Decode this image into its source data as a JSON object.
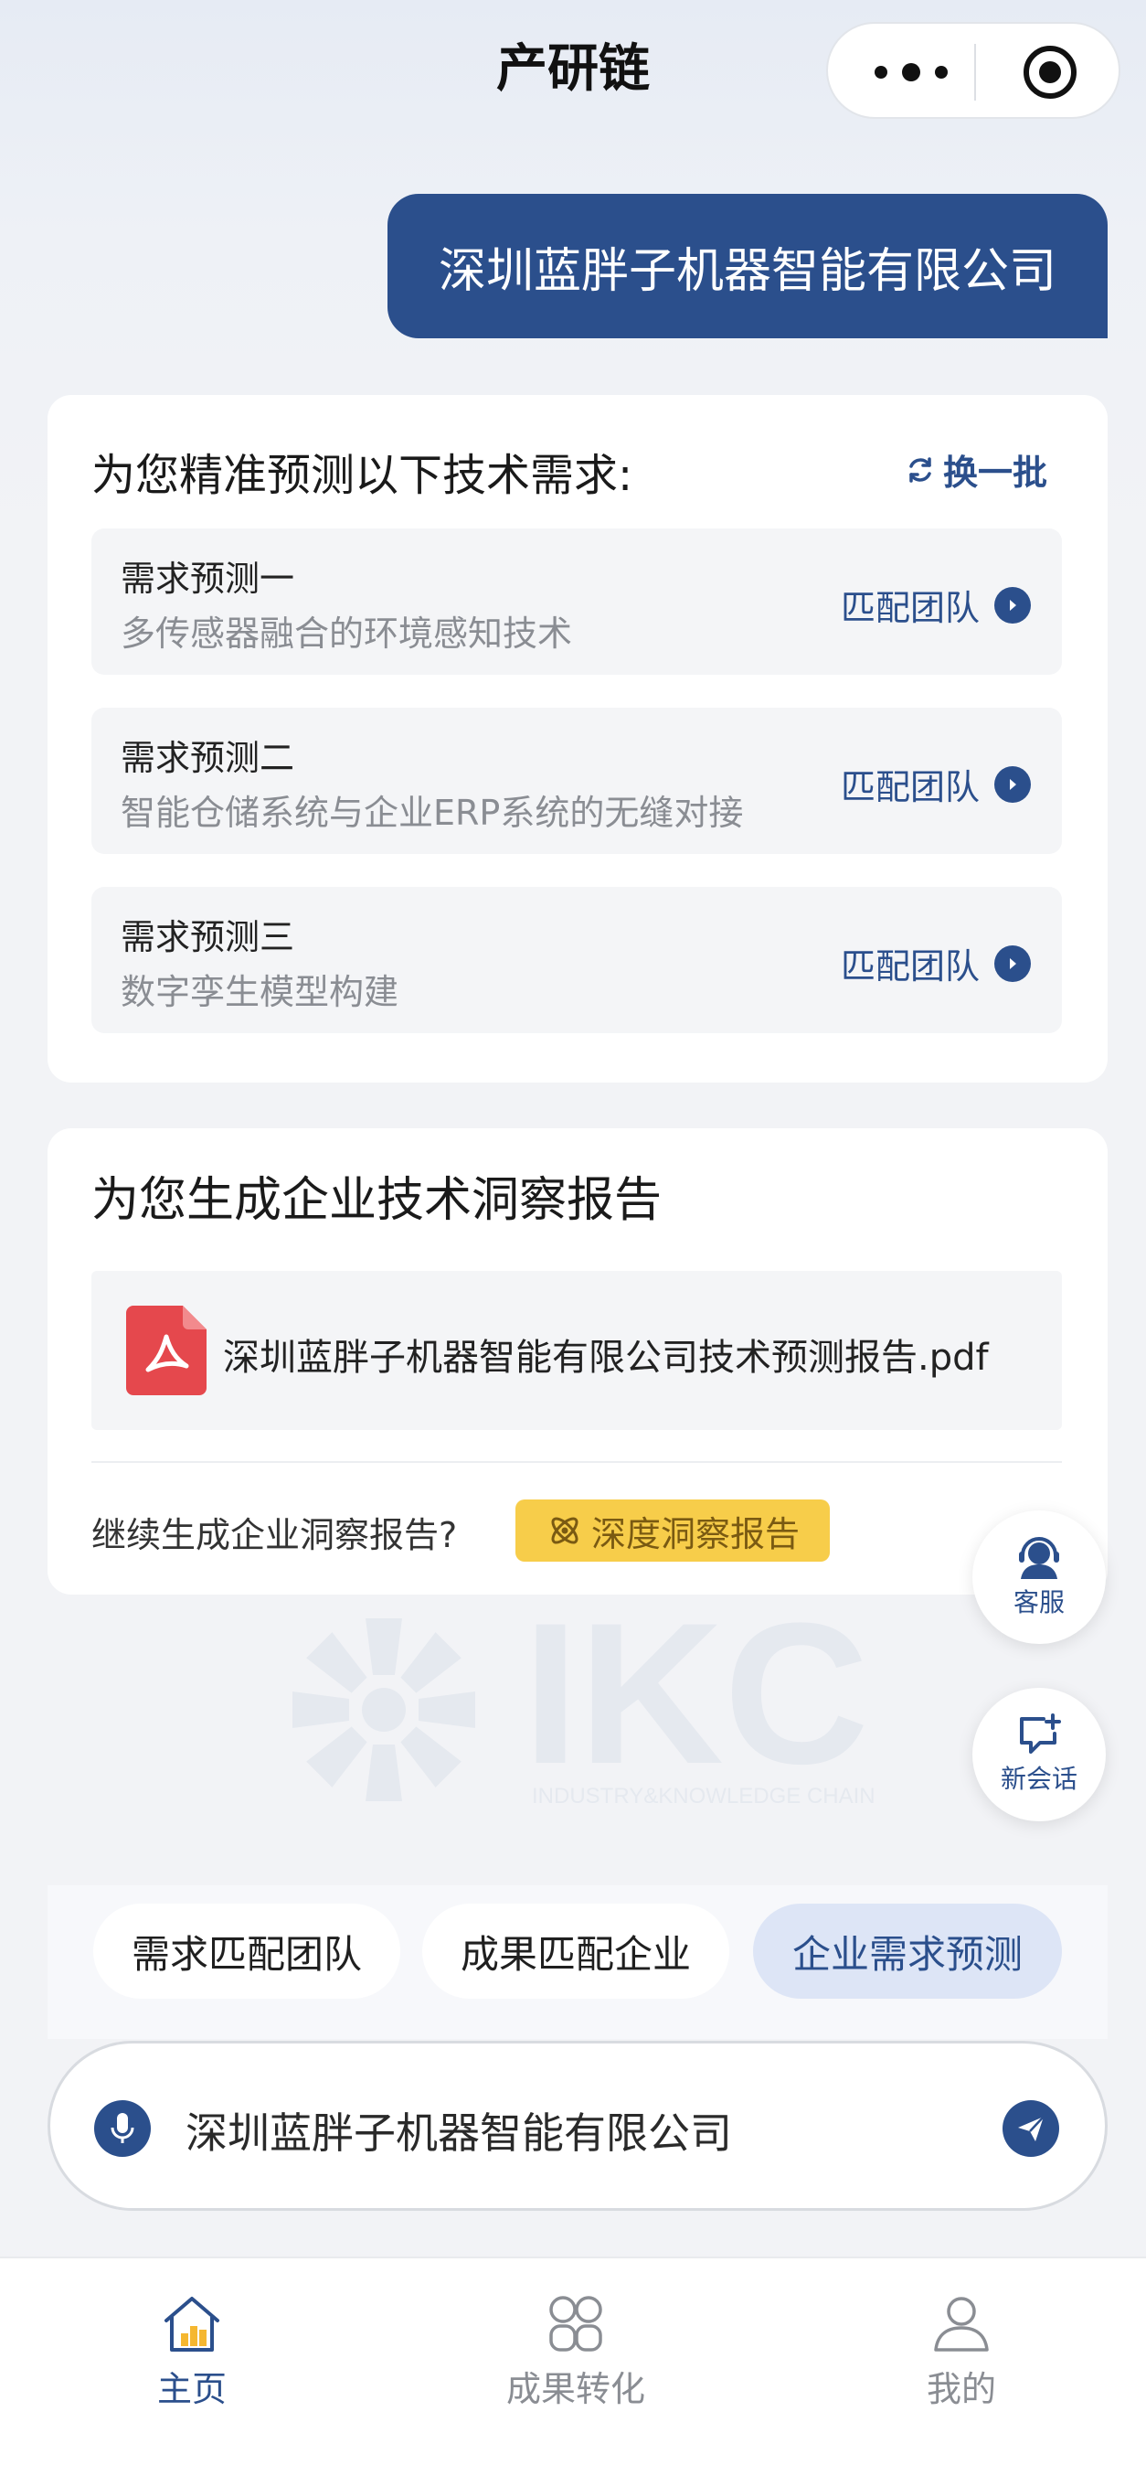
{
  "header": {
    "title": "产研链",
    "menu_icon": "more-dots-icon",
    "close_icon": "target-circle-icon"
  },
  "chat": {
    "user_message": "深圳蓝胖子机器智能有限公司"
  },
  "prediction_card": {
    "heading": "为您精准预测以下技术需求:",
    "refresh_label": "换一批",
    "items": [
      {
        "title": "需求预测一",
        "desc": "多传感器融合的环境感知技术",
        "action": "匹配团队"
      },
      {
        "title": "需求预测二",
        "desc": "智能仓储系统与企业ERP系统的无缝对接",
        "action": "匹配团队"
      },
      {
        "title": "需求预测三",
        "desc": "数字孪生模型构建",
        "action": "匹配团队"
      }
    ]
  },
  "report_card": {
    "heading": "为您生成企业技术洞察报告",
    "file_name": "深圳蓝胖子机器智能有限公司技术预测报告.pdf",
    "continue_text": "继续生成企业洞察报告?",
    "deep_report_label": "深度洞察报告"
  },
  "floating": {
    "customer_service": "客服",
    "new_session": "新会话"
  },
  "watermark": {
    "logo_text": "IKC",
    "tagline": "INDUSTRY&KNOWLEDGE CHAIN"
  },
  "chips": [
    "需求匹配团队",
    "成果匹配企业",
    "企业需求预测"
  ],
  "input": {
    "value": "深圳蓝胖子机器智能有限公司"
  },
  "nav": {
    "home": "主页",
    "results": "成果转化",
    "mine": "我的"
  },
  "colors": {
    "primary": "#2b4f8c",
    "accent_yellow": "#f7cd4a",
    "pdf_red": "#e5484d"
  }
}
